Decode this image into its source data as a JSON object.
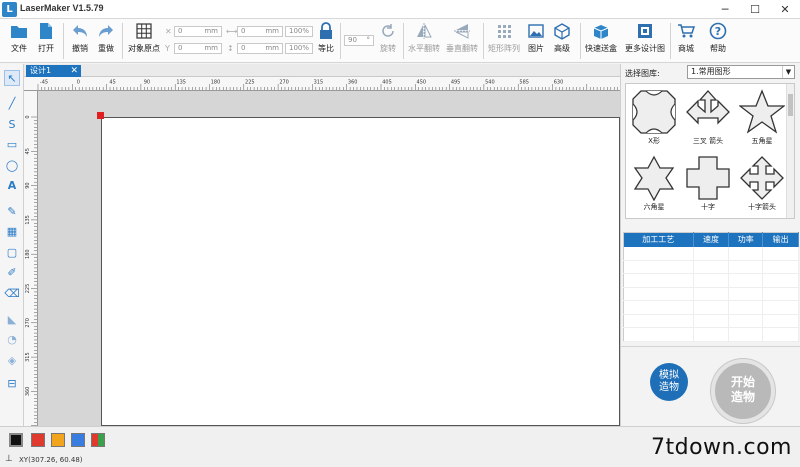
{
  "window": {
    "title": "LaserMaker V1.5.79",
    "logo": "L",
    "controls": {
      "minimize": "─",
      "maximize": "☐",
      "close": "✕"
    }
  },
  "toolbar": {
    "file": "文件",
    "open": "打开",
    "undo": "撤销",
    "redo": "重做",
    "object_origin": "对象原点",
    "x_value": "0",
    "y_value": "0",
    "width_value": "0",
    "height_value": "0",
    "unit_mm": "mm",
    "width_percent": "100",
    "height_percent": "100",
    "percent_sign": "%",
    "proportional": "等比",
    "rotation_value": "90",
    "rotate": "旋转",
    "flip_horizontal": "水平翻转",
    "flip_vertical": "垂直翻转",
    "rect_array": "矩形阵列",
    "image": "图片",
    "advanced": "高级",
    "quick_feed": "快速送盒",
    "more_designs": "更多设计图",
    "mall": "商城",
    "help": "帮助"
  },
  "tabs": [
    {
      "label": "设计1",
      "close": "✕"
    }
  ],
  "ruler": {
    "h_labels": [
      "-45",
      "0",
      "45",
      "90",
      "135",
      "180",
      "225",
      "270",
      "315",
      "360",
      "405",
      "450",
      "495",
      "540",
      "585",
      "630"
    ],
    "v_labels": [
      "0",
      "45",
      "90",
      "135",
      "180",
      "225",
      "270",
      "315",
      "360"
    ]
  },
  "library": {
    "label": "选择图库:",
    "selected": "1.常用图形",
    "shapes": [
      {
        "name": "X形",
        "icon": "x-shape-icon"
      },
      {
        "name": "三叉 箭头",
        "icon": "trident-arrow-icon"
      },
      {
        "name": "五角星",
        "icon": "five-point-star-icon"
      },
      {
        "name": "六角星",
        "icon": "six-point-star-icon"
      },
      {
        "name": "十字",
        "icon": "cross-icon"
      },
      {
        "name": "十字箭头",
        "icon": "cross-arrow-icon"
      }
    ]
  },
  "process_table": {
    "headers": [
      "加工工艺",
      "速度",
      "功率",
      "输出"
    ]
  },
  "buttons": {
    "simulate_line1": "模拟",
    "simulate_line2": "造物",
    "start_line1": "开始",
    "start_line2": "造物"
  },
  "colors": {
    "swatches": [
      "#111111",
      "#e03a2f",
      "#f2a51c",
      "#3a7de0",
      "multicolor"
    ],
    "accent": "#1e73be",
    "origin": "#e02020"
  },
  "status": {
    "coordinates": "XY(307.26, 60.48)"
  },
  "watermark": "7tdown.com"
}
